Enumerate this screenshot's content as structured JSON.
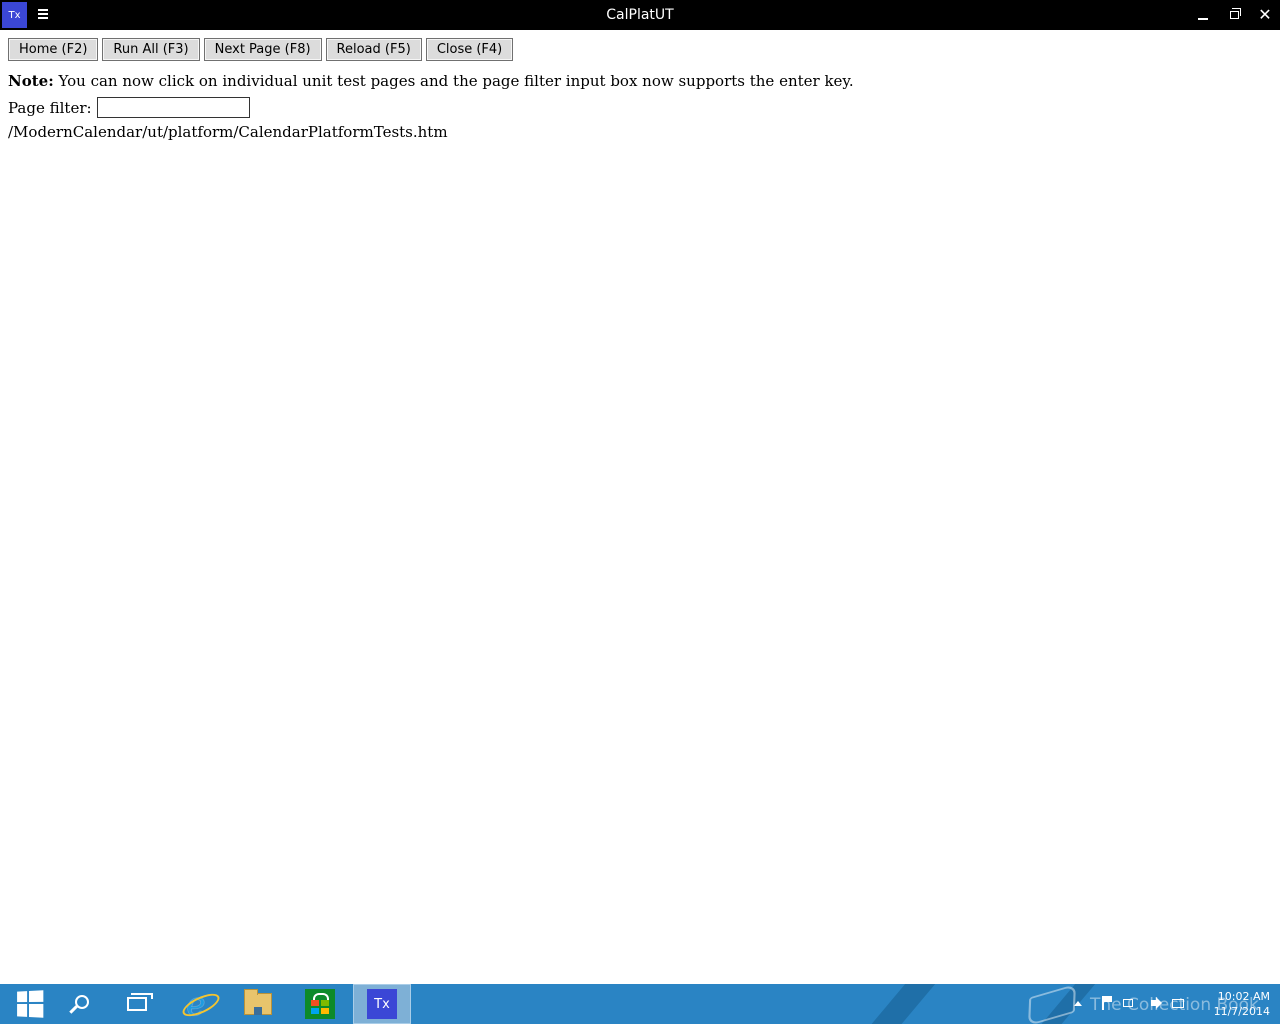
{
  "window": {
    "app_icon_text": "Tx",
    "title": "CalPlatUT"
  },
  "toolbar": {
    "buttons": [
      {
        "label": "Home (F2)"
      },
      {
        "label": "Run All (F3)"
      },
      {
        "label": "Next Page (F8)"
      },
      {
        "label": "Reload (F5)"
      },
      {
        "label": "Close (F4)"
      }
    ]
  },
  "note": {
    "label": "Note:",
    "text": "You can now click on individual unit test pages and the page filter input box now supports the enter key."
  },
  "filter": {
    "label": "Page filter:",
    "value": ""
  },
  "tests": {
    "items": [
      {
        "path": "/ModernCalendar/ut/platform/CalendarPlatformTests.htm"
      }
    ]
  },
  "taskbar": {
    "items": [
      {
        "icon": "windows-start-icon"
      },
      {
        "icon": "search-icon"
      },
      {
        "icon": "task-view-icon"
      },
      {
        "icon": "internet-explorer-icon"
      },
      {
        "icon": "file-explorer-icon"
      },
      {
        "icon": "store-icon"
      },
      {
        "icon": "tx-app-icon",
        "active": true,
        "label": "Tx"
      }
    ],
    "watermark": "The Collection Book",
    "clock": {
      "time": "10:02 AM",
      "date": "11/7/2014"
    }
  },
  "colors": {
    "title_bar": "#000000",
    "app_accent": "#3b47d6",
    "taskbar": "#2a84c4"
  }
}
